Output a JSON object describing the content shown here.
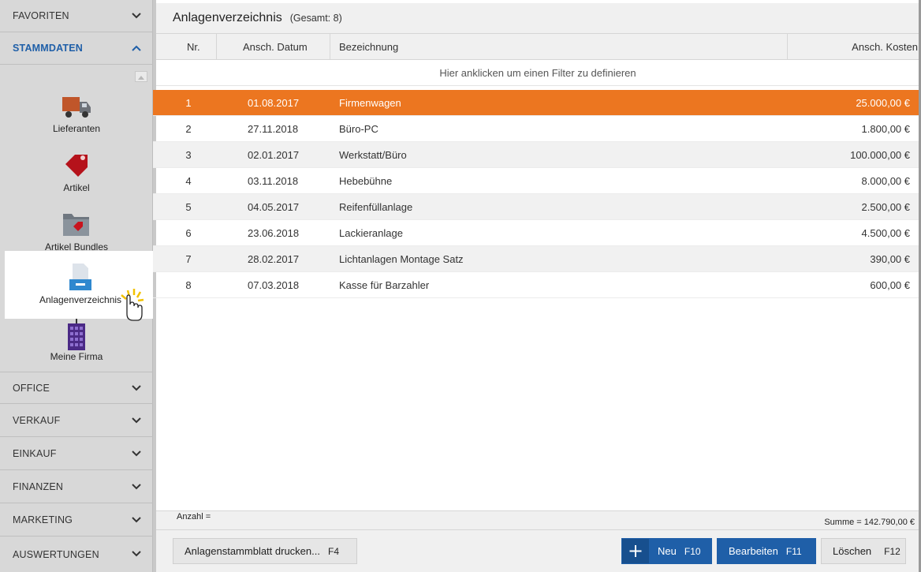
{
  "sidebar": {
    "sections_top": [
      {
        "label": "FAVORITEN"
      },
      {
        "label": "STAMMDATEN"
      }
    ],
    "items": [
      {
        "label": "Lieferanten",
        "icon": "truck-icon"
      },
      {
        "label": "Artikel",
        "icon": "price-tag-icon"
      },
      {
        "label": "Artikel Bundles",
        "icon": "folder-tag-icon"
      },
      {
        "label": "Anlagenverzeichnis",
        "icon": "document-tray-icon"
      },
      {
        "label": "Meine Firma",
        "icon": "building-icon"
      }
    ],
    "sections_bottom": [
      {
        "label": "OFFICE"
      },
      {
        "label": "VERKAUF"
      },
      {
        "label": "EINKAUF"
      },
      {
        "label": "FINANZEN"
      },
      {
        "label": "MARKETING"
      },
      {
        "label": "AUSWERTUNGEN"
      }
    ]
  },
  "header": {
    "title": "Anlagenverzeichnis",
    "count": "(Gesamt: 8)"
  },
  "grid": {
    "columns": [
      "Nr.",
      "Ansch. Datum",
      "Bezeichnung",
      "Ansch. Kosten"
    ],
    "filter_text": "Hier anklicken um einen Filter zu definieren",
    "rows": [
      {
        "nr": "1",
        "datum": "01.08.2017",
        "bezeichnung": "Firmenwagen",
        "kosten": "25.000,00 €"
      },
      {
        "nr": "2",
        "datum": "27.11.2018",
        "bezeichnung": "Büro-PC",
        "kosten": "1.800,00 €"
      },
      {
        "nr": "3",
        "datum": "02.01.2017",
        "bezeichnung": "Werkstatt/Büro",
        "kosten": "100.000,00 €"
      },
      {
        "nr": "4",
        "datum": "03.11.2018",
        "bezeichnung": "Hebebühne",
        "kosten": "8.000,00 €"
      },
      {
        "nr": "5",
        "datum": "04.05.2017",
        "bezeichnung": "Reifenfüllanlage",
        "kosten": "2.500,00 €"
      },
      {
        "nr": "6",
        "datum": "23.06.2018",
        "bezeichnung": "Lackieranlage",
        "kosten": "4.500,00 €"
      },
      {
        "nr": "7",
        "datum": "28.02.2017",
        "bezeichnung": "Lichtanlagen Montage Satz",
        "kosten": "390,00 €"
      },
      {
        "nr": "8",
        "datum": "07.03.2018",
        "bezeichnung": "Kasse für Barzahler",
        "kosten": "600,00 €"
      }
    ],
    "footer_count": "Anzahl =",
    "footer_sum": "Summe = 142.790,00 €"
  },
  "buttons": {
    "print": {
      "label": "Anlagenstammblatt  drucken...",
      "key": "F4"
    },
    "new": {
      "label": "Neu",
      "key": "F10"
    },
    "edit": {
      "label": "Bearbeiten",
      "key": "F11"
    },
    "delete": {
      "label": "Löschen",
      "key": "F12"
    }
  },
  "colors": {
    "accent_blue": "#1f5fa8",
    "selected_row": "#ec7620"
  }
}
